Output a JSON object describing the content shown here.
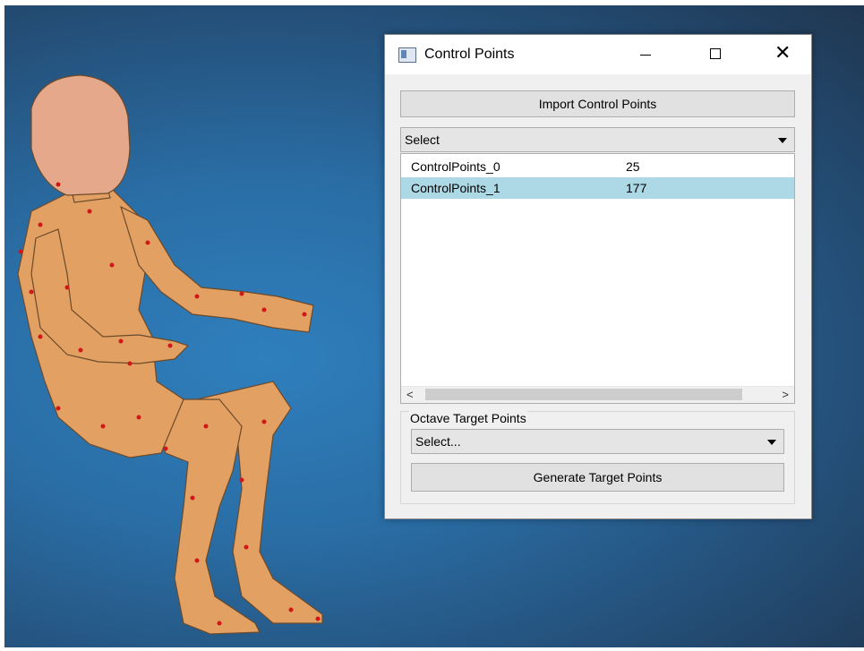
{
  "window": {
    "title": "Control Points",
    "title_icon": "app-window-icon",
    "controls": {
      "minimize": "minimize-icon",
      "maximize": "maximize-icon",
      "close": "close-icon",
      "close_glyph": "✕"
    }
  },
  "import_button": {
    "label": "Import Control Points"
  },
  "select_combo": {
    "value": "Select"
  },
  "control_point_sets": [
    {
      "name": "ControlPoints_0",
      "count": "25",
      "selected": false
    },
    {
      "name": "ControlPoints_1",
      "count": "177",
      "selected": true
    }
  ],
  "scrollbar": {
    "left_glyph": "<",
    "right_glyph": ">"
  },
  "octave_group": {
    "label": "Octave Target Points",
    "combo_value": "Select...",
    "generate_button": "Generate Target Points"
  },
  "colors": {
    "viewport_bg": "#2a6ea6",
    "figure_skin": "#e3a063",
    "control_point_marker": "#d01818",
    "selection_row": "#add8e6"
  }
}
